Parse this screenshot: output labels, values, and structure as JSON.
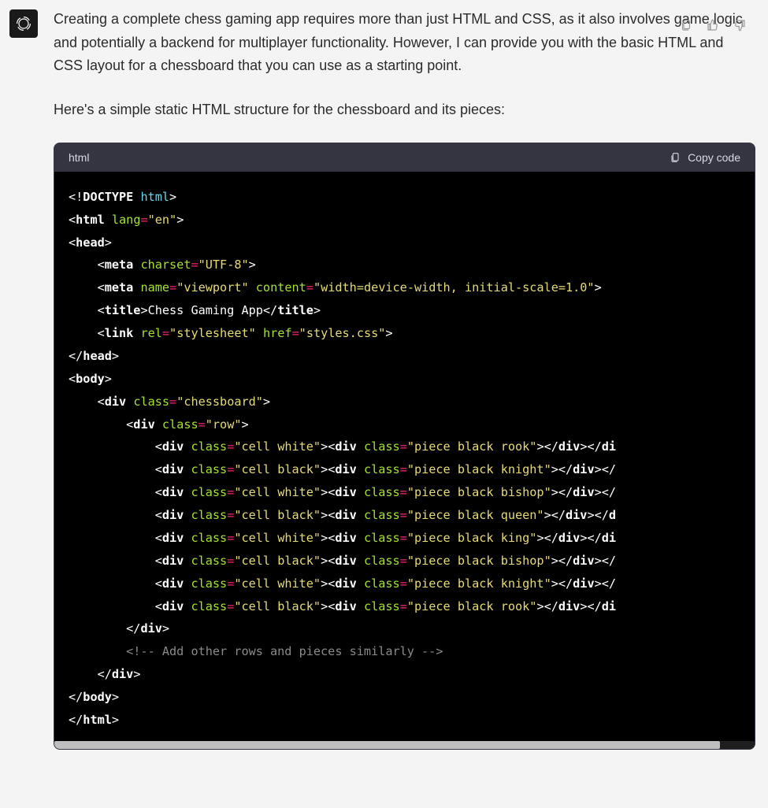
{
  "message": {
    "paragraph1": "Creating a complete chess gaming app requires more than just HTML and CSS, as it also involves game logic and potentially a backend for multiplayer functionality. However, I can provide you with the basic HTML and CSS layout for a chessboard that you can use as a starting point.",
    "paragraph2": "Here's a simple static HTML structure for the chessboard and its pieces:"
  },
  "codeblock": {
    "language": "html",
    "copy_label": "Copy code",
    "lines": [
      [
        [
          "punct",
          "<!"
        ],
        [
          "tag",
          "DOCTYPE "
        ],
        [
          "doct",
          "html"
        ],
        [
          "punct",
          ">"
        ]
      ],
      [
        [
          "punct",
          "<"
        ],
        [
          "tag",
          "html"
        ],
        [
          "punct",
          " "
        ],
        [
          "attr",
          "lang"
        ],
        [
          "op",
          "="
        ],
        [
          "str",
          "\"en\""
        ],
        [
          "punct",
          ">"
        ]
      ],
      [
        [
          "punct",
          "<"
        ],
        [
          "tag",
          "head"
        ],
        [
          "punct",
          ">"
        ]
      ],
      [
        [
          "punct",
          "    <"
        ],
        [
          "tag",
          "meta"
        ],
        [
          "punct",
          " "
        ],
        [
          "attr",
          "charset"
        ],
        [
          "op",
          "="
        ],
        [
          "str",
          "\"UTF-8\""
        ],
        [
          "punct",
          ">"
        ]
      ],
      [
        [
          "punct",
          "    <"
        ],
        [
          "tag",
          "meta"
        ],
        [
          "punct",
          " "
        ],
        [
          "attr",
          "name"
        ],
        [
          "op",
          "="
        ],
        [
          "str",
          "\"viewport\""
        ],
        [
          "punct",
          " "
        ],
        [
          "attr",
          "content"
        ],
        [
          "op",
          "="
        ],
        [
          "str",
          "\"width=device-width, initial-scale=1.0\""
        ],
        [
          "punct",
          ">"
        ]
      ],
      [
        [
          "punct",
          "    <"
        ],
        [
          "tag",
          "title"
        ],
        [
          "punct",
          ">"
        ],
        [
          "punct",
          "Chess Gaming App"
        ],
        [
          "punct",
          "</"
        ],
        [
          "tag",
          "title"
        ],
        [
          "punct",
          ">"
        ]
      ],
      [
        [
          "punct",
          "    <"
        ],
        [
          "tag",
          "link"
        ],
        [
          "punct",
          " "
        ],
        [
          "attr",
          "rel"
        ],
        [
          "op",
          "="
        ],
        [
          "str",
          "\"stylesheet\""
        ],
        [
          "punct",
          " "
        ],
        [
          "attr",
          "href"
        ],
        [
          "op",
          "="
        ],
        [
          "str",
          "\"styles.css\""
        ],
        [
          "punct",
          ">"
        ]
      ],
      [
        [
          "punct",
          "</"
        ],
        [
          "tag",
          "head"
        ],
        [
          "punct",
          ">"
        ]
      ],
      [
        [
          "punct",
          "<"
        ],
        [
          "tag",
          "body"
        ],
        [
          "punct",
          ">"
        ]
      ],
      [
        [
          "punct",
          "    <"
        ],
        [
          "tag",
          "div"
        ],
        [
          "punct",
          " "
        ],
        [
          "attr",
          "class"
        ],
        [
          "op",
          "="
        ],
        [
          "str",
          "\"chessboard\""
        ],
        [
          "punct",
          ">"
        ]
      ],
      [
        [
          "punct",
          "        <"
        ],
        [
          "tag",
          "div"
        ],
        [
          "punct",
          " "
        ],
        [
          "attr",
          "class"
        ],
        [
          "op",
          "="
        ],
        [
          "str",
          "\"row\""
        ],
        [
          "punct",
          ">"
        ]
      ],
      [
        [
          "punct",
          "            <"
        ],
        [
          "tag",
          "div"
        ],
        [
          "punct",
          " "
        ],
        [
          "attr",
          "class"
        ],
        [
          "op",
          "="
        ],
        [
          "str",
          "\"cell white\""
        ],
        [
          "punct",
          "><"
        ],
        [
          "tag",
          "div"
        ],
        [
          "punct",
          " "
        ],
        [
          "attr",
          "class"
        ],
        [
          "op",
          "="
        ],
        [
          "str",
          "\"piece black rook\""
        ],
        [
          "punct",
          "></"
        ],
        [
          "tag",
          "div"
        ],
        [
          "punct",
          "></"
        ],
        [
          "tag",
          "di"
        ]
      ],
      [
        [
          "punct",
          "            <"
        ],
        [
          "tag",
          "div"
        ],
        [
          "punct",
          " "
        ],
        [
          "attr",
          "class"
        ],
        [
          "op",
          "="
        ],
        [
          "str",
          "\"cell black\""
        ],
        [
          "punct",
          "><"
        ],
        [
          "tag",
          "div"
        ],
        [
          "punct",
          " "
        ],
        [
          "attr",
          "class"
        ],
        [
          "op",
          "="
        ],
        [
          "str",
          "\"piece black knight\""
        ],
        [
          "punct",
          "></"
        ],
        [
          "tag",
          "div"
        ],
        [
          "punct",
          "></"
        ]
      ],
      [
        [
          "punct",
          "            <"
        ],
        [
          "tag",
          "div"
        ],
        [
          "punct",
          " "
        ],
        [
          "attr",
          "class"
        ],
        [
          "op",
          "="
        ],
        [
          "str",
          "\"cell white\""
        ],
        [
          "punct",
          "><"
        ],
        [
          "tag",
          "div"
        ],
        [
          "punct",
          " "
        ],
        [
          "attr",
          "class"
        ],
        [
          "op",
          "="
        ],
        [
          "str",
          "\"piece black bishop\""
        ],
        [
          "punct",
          "></"
        ],
        [
          "tag",
          "div"
        ],
        [
          "punct",
          "></"
        ]
      ],
      [
        [
          "punct",
          "            <"
        ],
        [
          "tag",
          "div"
        ],
        [
          "punct",
          " "
        ],
        [
          "attr",
          "class"
        ],
        [
          "op",
          "="
        ],
        [
          "str",
          "\"cell black\""
        ],
        [
          "punct",
          "><"
        ],
        [
          "tag",
          "div"
        ],
        [
          "punct",
          " "
        ],
        [
          "attr",
          "class"
        ],
        [
          "op",
          "="
        ],
        [
          "str",
          "\"piece black queen\""
        ],
        [
          "punct",
          "></"
        ],
        [
          "tag",
          "div"
        ],
        [
          "punct",
          "></"
        ],
        [
          "tag",
          "d"
        ]
      ],
      [
        [
          "punct",
          "            <"
        ],
        [
          "tag",
          "div"
        ],
        [
          "punct",
          " "
        ],
        [
          "attr",
          "class"
        ],
        [
          "op",
          "="
        ],
        [
          "str",
          "\"cell white\""
        ],
        [
          "punct",
          "><"
        ],
        [
          "tag",
          "div"
        ],
        [
          "punct",
          " "
        ],
        [
          "attr",
          "class"
        ],
        [
          "op",
          "="
        ],
        [
          "str",
          "\"piece black king\""
        ],
        [
          "punct",
          "></"
        ],
        [
          "tag",
          "div"
        ],
        [
          "punct",
          "></"
        ],
        [
          "tag",
          "di"
        ]
      ],
      [
        [
          "punct",
          "            <"
        ],
        [
          "tag",
          "div"
        ],
        [
          "punct",
          " "
        ],
        [
          "attr",
          "class"
        ],
        [
          "op",
          "="
        ],
        [
          "str",
          "\"cell black\""
        ],
        [
          "punct",
          "><"
        ],
        [
          "tag",
          "div"
        ],
        [
          "punct",
          " "
        ],
        [
          "attr",
          "class"
        ],
        [
          "op",
          "="
        ],
        [
          "str",
          "\"piece black bishop\""
        ],
        [
          "punct",
          "></"
        ],
        [
          "tag",
          "div"
        ],
        [
          "punct",
          "></"
        ]
      ],
      [
        [
          "punct",
          "            <"
        ],
        [
          "tag",
          "div"
        ],
        [
          "punct",
          " "
        ],
        [
          "attr",
          "class"
        ],
        [
          "op",
          "="
        ],
        [
          "str",
          "\"cell white\""
        ],
        [
          "punct",
          "><"
        ],
        [
          "tag",
          "div"
        ],
        [
          "punct",
          " "
        ],
        [
          "attr",
          "class"
        ],
        [
          "op",
          "="
        ],
        [
          "str",
          "\"piece black knight\""
        ],
        [
          "punct",
          "></"
        ],
        [
          "tag",
          "div"
        ],
        [
          "punct",
          "></"
        ]
      ],
      [
        [
          "punct",
          "            <"
        ],
        [
          "tag",
          "div"
        ],
        [
          "punct",
          " "
        ],
        [
          "attr",
          "class"
        ],
        [
          "op",
          "="
        ],
        [
          "str",
          "\"cell black\""
        ],
        [
          "punct",
          "><"
        ],
        [
          "tag",
          "div"
        ],
        [
          "punct",
          " "
        ],
        [
          "attr",
          "class"
        ],
        [
          "op",
          "="
        ],
        [
          "str",
          "\"piece black rook\""
        ],
        [
          "punct",
          "></"
        ],
        [
          "tag",
          "div"
        ],
        [
          "punct",
          "></"
        ],
        [
          "tag",
          "di"
        ]
      ],
      [
        [
          "punct",
          "        </"
        ],
        [
          "tag",
          "div"
        ],
        [
          "punct",
          ">"
        ]
      ],
      [
        [
          "com",
          "        <!-- Add other rows and pieces similarly -->"
        ]
      ],
      [
        [
          "punct",
          "    </"
        ],
        [
          "tag",
          "div"
        ],
        [
          "punct",
          ">"
        ]
      ],
      [
        [
          "punct",
          "</"
        ],
        [
          "tag",
          "body"
        ],
        [
          "punct",
          ">"
        ]
      ],
      [
        [
          "punct",
          "</"
        ],
        [
          "tag",
          "html"
        ],
        [
          "punct",
          ">"
        ]
      ]
    ]
  }
}
